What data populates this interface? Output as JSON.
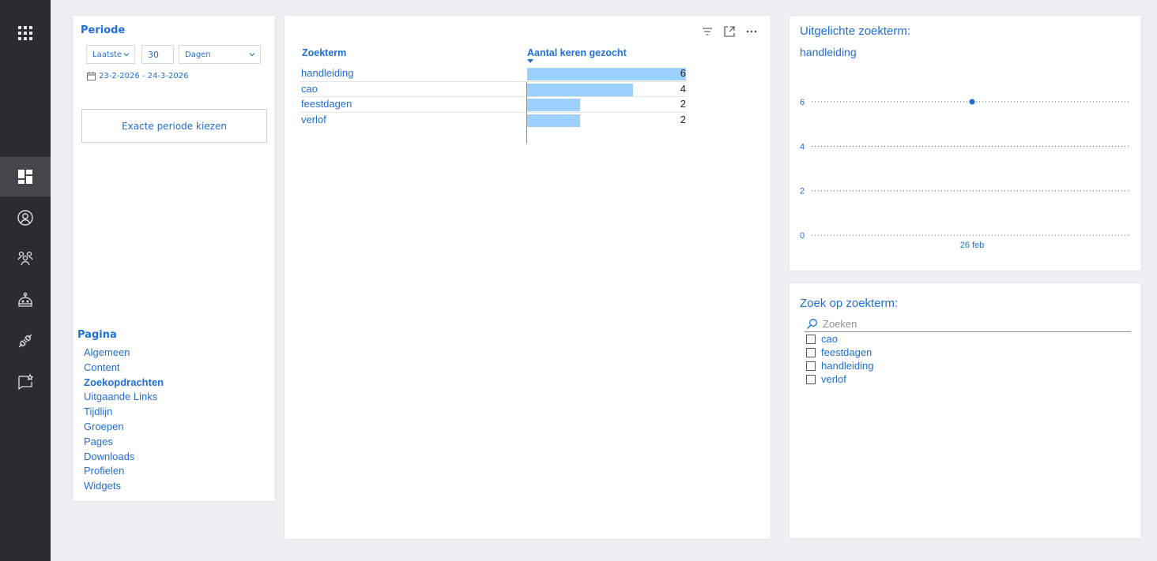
{
  "rail": {
    "items": [
      {
        "icon": "apps-grid-icon"
      },
      {
        "icon": "dashboard-icon",
        "active": true
      },
      {
        "icon": "user-icon"
      },
      {
        "icon": "groups-icon"
      },
      {
        "icon": "bot-icon"
      },
      {
        "icon": "plug-icon"
      },
      {
        "icon": "feedback-icon"
      }
    ]
  },
  "periode": {
    "title": "Periode",
    "range_mode": "Laatste",
    "amount": "30",
    "unit": "Dagen",
    "date_range": "23-2-2026 - 24-3-2026",
    "exact_button": "Exacte periode kiezen"
  },
  "pagina": {
    "title": "Pagina",
    "items": [
      {
        "label": "Algemeen"
      },
      {
        "label": "Content"
      },
      {
        "label": "Zoekopdrachten",
        "active": true
      },
      {
        "label": "Uitgaande Links"
      },
      {
        "label": "Tijdlijn"
      },
      {
        "label": "Groepen"
      },
      {
        "label": "Pages"
      },
      {
        "label": "Downloads"
      },
      {
        "label": "Profielen"
      },
      {
        "label": "Widgets"
      }
    ]
  },
  "table": {
    "col_term": "Zoekterm",
    "col_count": "Aantal keren gezocht",
    "max": 6,
    "rows": [
      {
        "term": "handleiding",
        "count": 6
      },
      {
        "term": "cao",
        "count": 4
      },
      {
        "term": "feestdagen",
        "count": 2
      },
      {
        "term": "verlof",
        "count": 2
      }
    ]
  },
  "highlight": {
    "title": "Uitgelichte zoekterm:",
    "term": "handleiding"
  },
  "chart_data": {
    "type": "line",
    "title": "",
    "x": [
      "26 feb"
    ],
    "series": [
      {
        "values": [
          6
        ]
      }
    ],
    "y_ticks": [
      0,
      2,
      4,
      6
    ],
    "ylim": [
      0,
      6
    ],
    "grid": true,
    "colors": {
      "marker": "#1f6fd6",
      "grid": "#1f6fd6"
    }
  },
  "search": {
    "title": "Zoek op zoekterm:",
    "placeholder": "Zoeken",
    "options": [
      "cao",
      "feestdagen",
      "handleiding",
      "verlof"
    ]
  },
  "colors": {
    "accent": "#1f6fd6",
    "bar": "#9bd0ff",
    "rail": "#2b2c30"
  }
}
